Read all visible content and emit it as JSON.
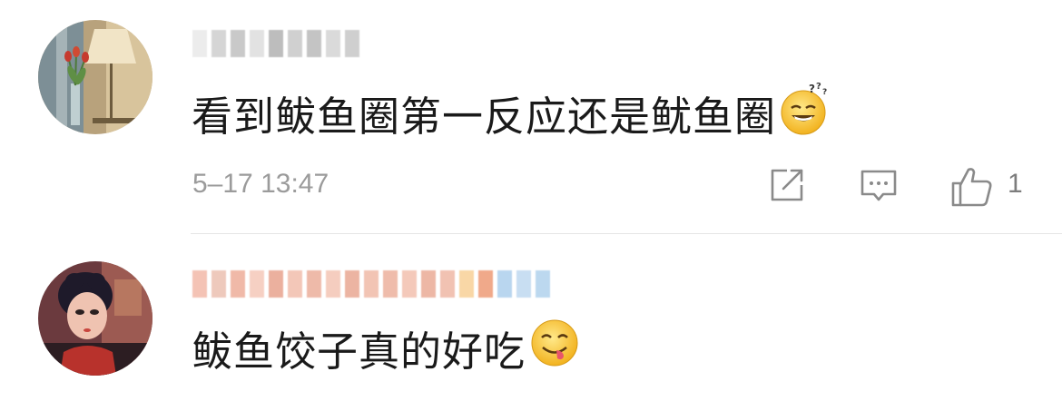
{
  "comments": [
    {
      "text": "看到鲅鱼圈第一反应还是鱿鱼圈",
      "timestamp": "5–17 13:47",
      "emoji": "sleepy-grin-emoji",
      "actions": {
        "share": "share-icon",
        "reply": "comment-icon",
        "like": "thumbs-up-icon",
        "like_count": "1"
      }
    },
    {
      "text": "鲅鱼饺子真的好吃",
      "emoji": "yum-tongue-emoji"
    }
  ],
  "colors": {
    "text": "#1a1a1a",
    "meta": "#9b9b9b",
    "icon": "#8a8a8a",
    "divider": "#e6e6e6"
  }
}
